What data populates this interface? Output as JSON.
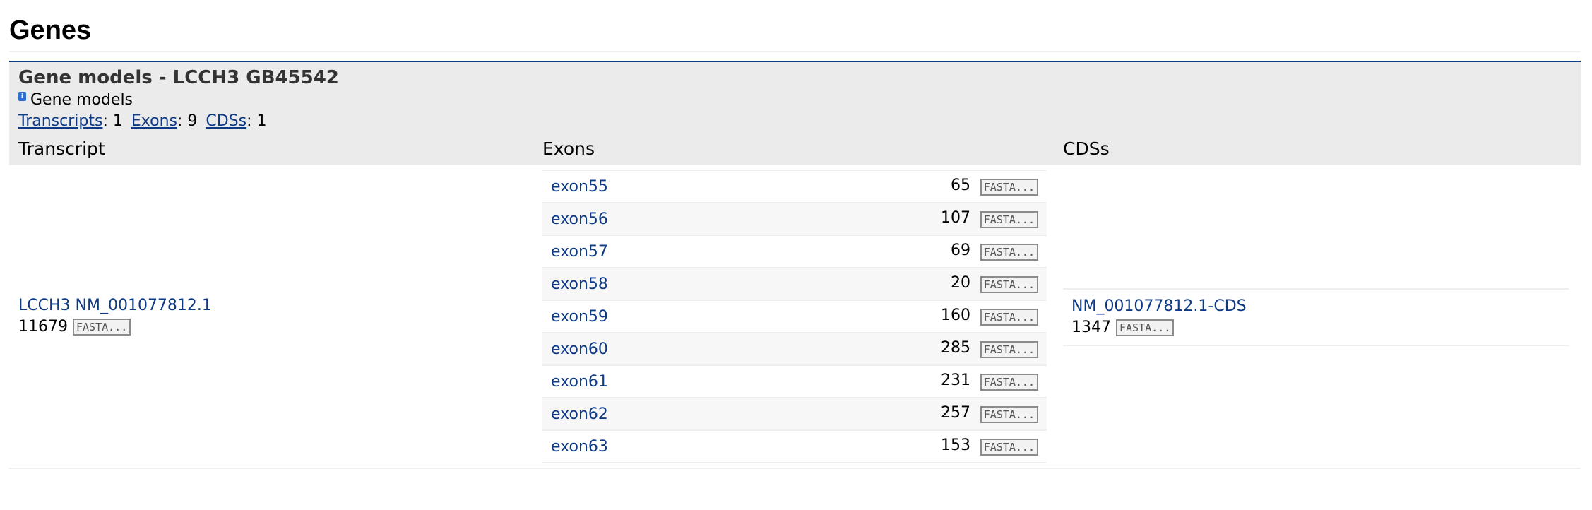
{
  "page": {
    "title": "Genes"
  },
  "gene_models": {
    "title": "Gene models - LCCH3 GB45542",
    "subtitle": "Gene models",
    "counts": {
      "transcripts_label": "Transcripts",
      "transcripts_value": "1",
      "exons_label": "Exons",
      "exons_value": "9",
      "cdss_label": "CDSs",
      "cdss_value": "1"
    },
    "columns": {
      "transcript": "Transcript",
      "exons": "Exons",
      "cdss": "CDSs"
    },
    "fasta_label": "FASTA...",
    "transcript": {
      "name": "LCCH3 NM_001077812.1",
      "length": "11679"
    },
    "exons": [
      {
        "name": "exon55",
        "length": "65"
      },
      {
        "name": "exon56",
        "length": "107"
      },
      {
        "name": "exon57",
        "length": "69"
      },
      {
        "name": "exon58",
        "length": "20"
      },
      {
        "name": "exon59",
        "length": "160"
      },
      {
        "name": "exon60",
        "length": "285"
      },
      {
        "name": "exon61",
        "length": "231"
      },
      {
        "name": "exon62",
        "length": "257"
      },
      {
        "name": "exon63",
        "length": "153"
      }
    ],
    "cds": {
      "name": "NM_001077812.1-CDS",
      "length": "1347"
    }
  }
}
